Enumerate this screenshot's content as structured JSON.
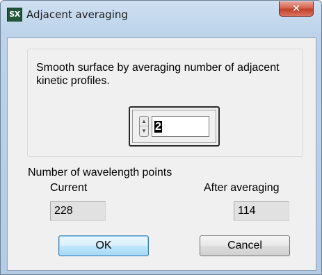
{
  "window": {
    "title": "Adjacent averaging",
    "icon_text": "SX",
    "close_glyph": "✕"
  },
  "content": {
    "description": "Smooth surface by averaging number of adjacent kinetic profiles.",
    "averaging_number": "2",
    "spin_up_glyph": "▲",
    "spin_down_glyph": "▼",
    "wavelength_points_label": "Number of wavelength points",
    "current_label": "Current",
    "current_value": "228",
    "after_label": "After averaging",
    "after_value": "114"
  },
  "buttons": {
    "ok_label": "OK",
    "cancel_label": "Cancel"
  }
}
